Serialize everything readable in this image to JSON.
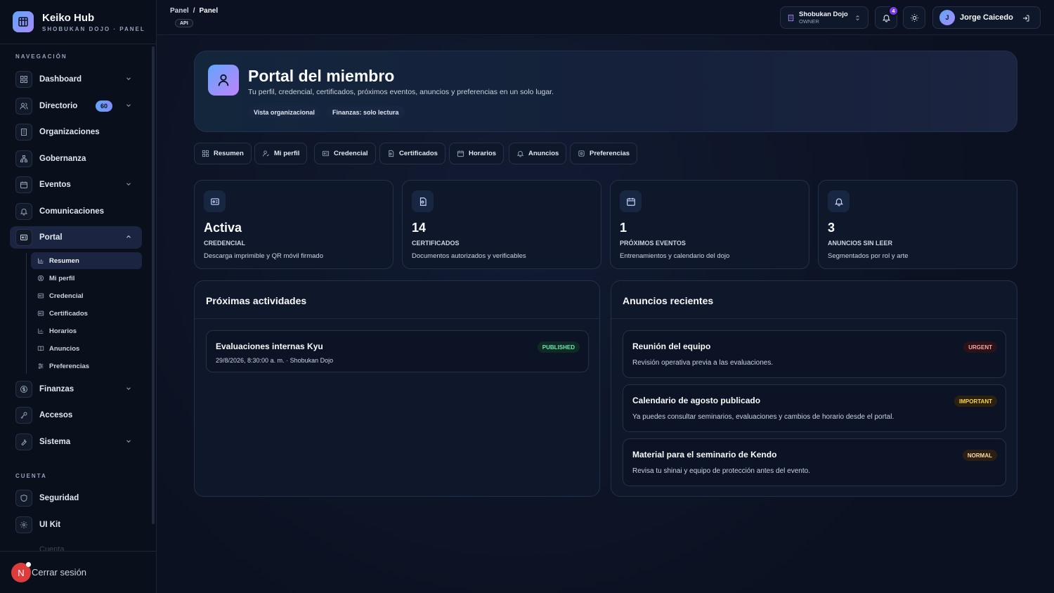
{
  "brand": {
    "title": "Keiko Hub",
    "subtitle": "SHOBUKAN DOJO · PANEL"
  },
  "sidebar": {
    "section_nav": "NAVEGACIÓN",
    "section_account": "CUENTA",
    "items": [
      {
        "label": "Dashboard",
        "icon": "grid-icon"
      },
      {
        "label": "Directorio",
        "icon": "users-icon",
        "badge": "60"
      },
      {
        "label": "Organizaciones",
        "icon": "building-icon"
      },
      {
        "label": "Gobernanza",
        "icon": "network-icon"
      },
      {
        "label": "Eventos",
        "icon": "calendar-icon"
      },
      {
        "label": "Comunicaciones",
        "icon": "bell-icon"
      },
      {
        "label": "Portal",
        "icon": "id-card-icon"
      },
      {
        "label": "Finanzas",
        "icon": "dollar-icon"
      },
      {
        "label": "Accesos",
        "icon": "key-icon"
      },
      {
        "label": "Sistema",
        "icon": "wrench-icon"
      }
    ],
    "portal_sub": [
      {
        "label": "Resumen",
        "icon": "bar-chart-icon"
      },
      {
        "label": "Mi perfil",
        "icon": "user-circle-icon"
      },
      {
        "label": "Credencial",
        "icon": "id-card-icon"
      },
      {
        "label": "Certificados",
        "icon": "id-card-icon"
      },
      {
        "label": "Horarios",
        "icon": "bar-chart-icon"
      },
      {
        "label": "Anuncios",
        "icon": "book-icon"
      },
      {
        "label": "Preferencias",
        "icon": "sliders-icon"
      }
    ],
    "account_items": [
      {
        "label": "Seguridad",
        "icon": "shield-icon"
      },
      {
        "label": "UI Kit",
        "icon": "gear-icon"
      }
    ],
    "faded_item": "Cuenta",
    "footer": {
      "avatar_letter": "N",
      "logout": "Cerrar sesión"
    }
  },
  "topbar": {
    "breadcrumb": [
      "Panel",
      "Panel"
    ],
    "breadcrumb_sep": "/",
    "api_label": "API",
    "org": {
      "name": "Shobukan Dojo",
      "role": "OWNER"
    },
    "notifications_count": "4",
    "user": {
      "initial": "J",
      "name": "Jorge Caicedo"
    }
  },
  "hero": {
    "title": "Portal del miembro",
    "description": "Tu perfil, credencial, certificados, próximos eventos, anuncios y preferencias en un solo lugar.",
    "tags": [
      "Vista organizacional",
      "Finanzas: solo lectura"
    ]
  },
  "tabs": [
    "Resumen",
    "Mi perfil",
    "Credencial",
    "Certificados",
    "Horarios",
    "Anuncios",
    "Preferencias"
  ],
  "stats": [
    {
      "value": "Activa",
      "label": "CREDENCIAL",
      "description": "Descarga imprimible y QR móvil firmado"
    },
    {
      "value": "14",
      "label": "CERTIFICADOS",
      "description": "Documentos autorizados y verificables"
    },
    {
      "value": "1",
      "label": "PRÓXIMOS EVENTOS",
      "description": "Entrenamientos y calendario del dojo"
    },
    {
      "value": "3",
      "label": "ANUNCIOS SIN LEER",
      "description": "Segmentados por rol y arte"
    }
  ],
  "activities": {
    "title": "Próximas actividades",
    "items": [
      {
        "title": "Evaluaciones internas Kyu",
        "meta": "29/8/2026, 8:30:00 a. m. · Shobukan Dojo",
        "status": "PUBLISHED"
      }
    ]
  },
  "announcements": {
    "title": "Anuncios recientes",
    "items": [
      {
        "title": "Reunión del equipo",
        "description": "Revisión operativa previa a las evaluaciones.",
        "priority": "URGENT"
      },
      {
        "title": "Calendario de agosto publicado",
        "description": "Ya puedes consultar seminarios, evaluaciones y cambios de horario desde el portal.",
        "priority": "IMPORTANT"
      },
      {
        "title": "Material para el seminario de Kendo",
        "description": "Revisa tu shinai y equipo de protección antes del evento.",
        "priority": "NORMAL"
      }
    ]
  },
  "colors": {
    "background": "#0b1120",
    "accent_gradient_start": "#60a5fa",
    "accent_gradient_end": "#a78bfa",
    "published": "#4ade80",
    "urgent": "#f87171",
    "important": "#fbbf24",
    "normal": "#fcd9a5"
  }
}
